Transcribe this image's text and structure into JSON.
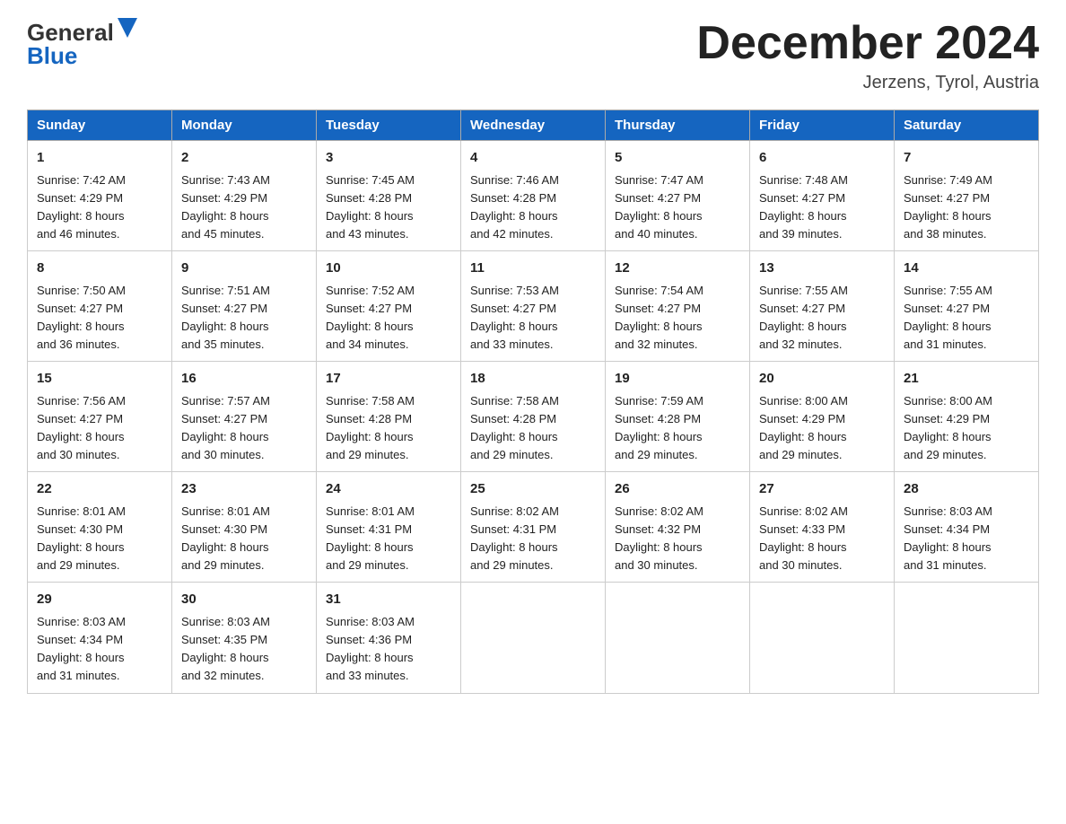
{
  "header": {
    "logo_general": "General",
    "logo_blue": "Blue",
    "month_title": "December 2024",
    "location": "Jerzens, Tyrol, Austria"
  },
  "days_of_week": [
    "Sunday",
    "Monday",
    "Tuesday",
    "Wednesday",
    "Thursday",
    "Friday",
    "Saturday"
  ],
  "weeks": [
    [
      {
        "day": "1",
        "sunrise": "7:42 AM",
        "sunset": "4:29 PM",
        "daylight": "8 hours and 46 minutes."
      },
      {
        "day": "2",
        "sunrise": "7:43 AM",
        "sunset": "4:29 PM",
        "daylight": "8 hours and 45 minutes."
      },
      {
        "day": "3",
        "sunrise": "7:45 AM",
        "sunset": "4:28 PM",
        "daylight": "8 hours and 43 minutes."
      },
      {
        "day": "4",
        "sunrise": "7:46 AM",
        "sunset": "4:28 PM",
        "daylight": "8 hours and 42 minutes."
      },
      {
        "day": "5",
        "sunrise": "7:47 AM",
        "sunset": "4:27 PM",
        "daylight": "8 hours and 40 minutes."
      },
      {
        "day": "6",
        "sunrise": "7:48 AM",
        "sunset": "4:27 PM",
        "daylight": "8 hours and 39 minutes."
      },
      {
        "day": "7",
        "sunrise": "7:49 AM",
        "sunset": "4:27 PM",
        "daylight": "8 hours and 38 minutes."
      }
    ],
    [
      {
        "day": "8",
        "sunrise": "7:50 AM",
        "sunset": "4:27 PM",
        "daylight": "8 hours and 36 minutes."
      },
      {
        "day": "9",
        "sunrise": "7:51 AM",
        "sunset": "4:27 PM",
        "daylight": "8 hours and 35 minutes."
      },
      {
        "day": "10",
        "sunrise": "7:52 AM",
        "sunset": "4:27 PM",
        "daylight": "8 hours and 34 minutes."
      },
      {
        "day": "11",
        "sunrise": "7:53 AM",
        "sunset": "4:27 PM",
        "daylight": "8 hours and 33 minutes."
      },
      {
        "day": "12",
        "sunrise": "7:54 AM",
        "sunset": "4:27 PM",
        "daylight": "8 hours and 32 minutes."
      },
      {
        "day": "13",
        "sunrise": "7:55 AM",
        "sunset": "4:27 PM",
        "daylight": "8 hours and 32 minutes."
      },
      {
        "day": "14",
        "sunrise": "7:55 AM",
        "sunset": "4:27 PM",
        "daylight": "8 hours and 31 minutes."
      }
    ],
    [
      {
        "day": "15",
        "sunrise": "7:56 AM",
        "sunset": "4:27 PM",
        "daylight": "8 hours and 30 minutes."
      },
      {
        "day": "16",
        "sunrise": "7:57 AM",
        "sunset": "4:27 PM",
        "daylight": "8 hours and 30 minutes."
      },
      {
        "day": "17",
        "sunrise": "7:58 AM",
        "sunset": "4:28 PM",
        "daylight": "8 hours and 29 minutes."
      },
      {
        "day": "18",
        "sunrise": "7:58 AM",
        "sunset": "4:28 PM",
        "daylight": "8 hours and 29 minutes."
      },
      {
        "day": "19",
        "sunrise": "7:59 AM",
        "sunset": "4:28 PM",
        "daylight": "8 hours and 29 minutes."
      },
      {
        "day": "20",
        "sunrise": "8:00 AM",
        "sunset": "4:29 PM",
        "daylight": "8 hours and 29 minutes."
      },
      {
        "day": "21",
        "sunrise": "8:00 AM",
        "sunset": "4:29 PM",
        "daylight": "8 hours and 29 minutes."
      }
    ],
    [
      {
        "day": "22",
        "sunrise": "8:01 AM",
        "sunset": "4:30 PM",
        "daylight": "8 hours and 29 minutes."
      },
      {
        "day": "23",
        "sunrise": "8:01 AM",
        "sunset": "4:30 PM",
        "daylight": "8 hours and 29 minutes."
      },
      {
        "day": "24",
        "sunrise": "8:01 AM",
        "sunset": "4:31 PM",
        "daylight": "8 hours and 29 minutes."
      },
      {
        "day": "25",
        "sunrise": "8:02 AM",
        "sunset": "4:31 PM",
        "daylight": "8 hours and 29 minutes."
      },
      {
        "day": "26",
        "sunrise": "8:02 AM",
        "sunset": "4:32 PM",
        "daylight": "8 hours and 30 minutes."
      },
      {
        "day": "27",
        "sunrise": "8:02 AM",
        "sunset": "4:33 PM",
        "daylight": "8 hours and 30 minutes."
      },
      {
        "day": "28",
        "sunrise": "8:03 AM",
        "sunset": "4:34 PM",
        "daylight": "8 hours and 31 minutes."
      }
    ],
    [
      {
        "day": "29",
        "sunrise": "8:03 AM",
        "sunset": "4:34 PM",
        "daylight": "8 hours and 31 minutes."
      },
      {
        "day": "30",
        "sunrise": "8:03 AM",
        "sunset": "4:35 PM",
        "daylight": "8 hours and 32 minutes."
      },
      {
        "day": "31",
        "sunrise": "8:03 AM",
        "sunset": "4:36 PM",
        "daylight": "8 hours and 33 minutes."
      },
      null,
      null,
      null,
      null
    ]
  ],
  "labels": {
    "sunrise": "Sunrise:",
    "sunset": "Sunset:",
    "daylight": "Daylight:"
  }
}
